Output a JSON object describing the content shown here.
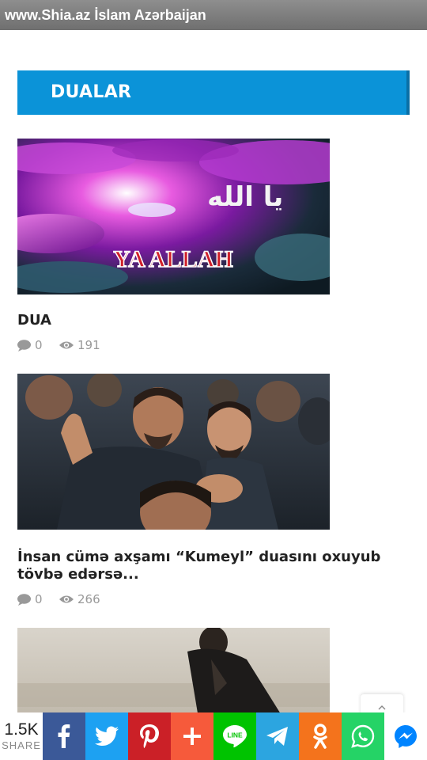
{
  "window": {
    "title": "www.Shia.az İslam Azərbaijan"
  },
  "section": {
    "title": "DUALAR"
  },
  "posts": [
    {
      "title": "DUA",
      "comments": "0",
      "views": "191",
      "image_text": "YA ALLAH",
      "image_arabic": "يا الله"
    },
    {
      "title": "İnsan cümə axşamı “Kumeyl” duasını oxuyub tövbə edərsə...",
      "comments": "0",
      "views": "266"
    },
    {
      "title": ""
    }
  ],
  "share": {
    "count": "1.5K",
    "label": "SHARE",
    "buttons": [
      {
        "name": "facebook",
        "color": "#3b5998",
        "icon": "facebook-icon"
      },
      {
        "name": "twitter",
        "color": "#1da1f2",
        "icon": "twitter-icon"
      },
      {
        "name": "pinterest",
        "color": "#cb2027",
        "icon": "pinterest-icon"
      },
      {
        "name": "more",
        "color": "#f65a3b",
        "icon": "plus-icon"
      },
      {
        "name": "line",
        "color": "#00c300",
        "icon": "line-icon"
      },
      {
        "name": "telegram",
        "color": "#2ca5e0",
        "icon": "telegram-icon"
      },
      {
        "name": "odnoklassniki",
        "color": "#f4731c",
        "icon": "odnoklassniki-icon"
      },
      {
        "name": "whatsapp",
        "color": "#25d366",
        "icon": "whatsapp-icon"
      },
      {
        "name": "messenger",
        "color": "#0084ff",
        "icon": "messenger-icon"
      }
    ]
  },
  "colors": {
    "accent": "#0b93d8",
    "title_bar": "#7d7d7d",
    "meta": "#999999"
  }
}
